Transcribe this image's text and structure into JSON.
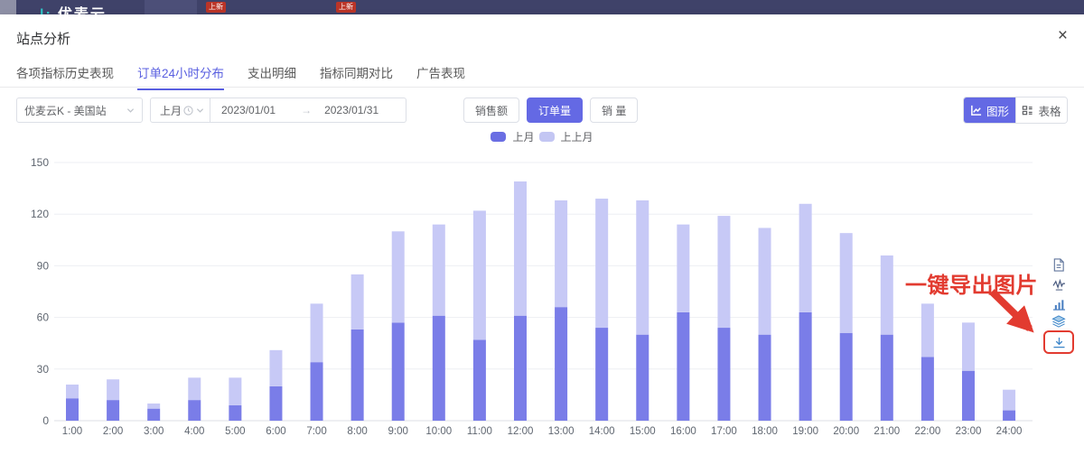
{
  "topbar": {
    "logo": "优麦云",
    "nav_badge_1": "上新",
    "nav_badge_2": "上新"
  },
  "modal": {
    "title": "站点分析",
    "close": "×"
  },
  "tabs": [
    {
      "label": "各项指标历史表现",
      "active": false
    },
    {
      "label": "订单24小时分布",
      "active": true
    },
    {
      "label": "支出明细",
      "active": false
    },
    {
      "label": "指标同期对比",
      "active": false
    },
    {
      "label": "广告表现",
      "active": false
    }
  ],
  "filters": {
    "site": "优麦云K - 美国站",
    "period": "上月",
    "date_start": "2023/01/01",
    "date_arrow": "→",
    "date_end": "2023/01/31"
  },
  "metric_buttons": [
    {
      "label": "销售额",
      "active": false
    },
    {
      "label": "订单量",
      "active": true
    },
    {
      "label": "销 量",
      "active": false
    }
  ],
  "view_toggle": [
    {
      "label": "图形",
      "active": true,
      "icon": "chart-icon"
    },
    {
      "label": "表格",
      "active": false,
      "icon": "table-icon"
    }
  ],
  "annotation": {
    "text": "一键导出图片",
    "color": "#e23b30"
  },
  "side_icons": [
    "document-icon",
    "trend-line-icon",
    "bar-chart-icon",
    "layers-icon",
    "download-icon"
  ],
  "chart_data": {
    "type": "bar",
    "stacked": true,
    "title": "",
    "xlabel": "",
    "ylabel": "",
    "ylim": [
      0,
      150
    ],
    "yticks": [
      0,
      30,
      60,
      90,
      120,
      150
    ],
    "grid": true,
    "legend_position": "top-center",
    "categories": [
      "1:00",
      "2:00",
      "3:00",
      "4:00",
      "5:00",
      "6:00",
      "7:00",
      "8:00",
      "9:00",
      "10:00",
      "11:00",
      "12:00",
      "13:00",
      "14:00",
      "15:00",
      "16:00",
      "17:00",
      "18:00",
      "19:00",
      "20:00",
      "21:00",
      "22:00",
      "23:00",
      "24:00"
    ],
    "series": [
      {
        "name": "上月",
        "color": "#7a7de8",
        "values": [
          13,
          12,
          7,
          12,
          9,
          20,
          34,
          53,
          57,
          61,
          47,
          61,
          66,
          54,
          50,
          63,
          54,
          50,
          63,
          51,
          50,
          37,
          29,
          6
        ]
      },
      {
        "name": "上上月",
        "color": "#c7c9f6",
        "values": [
          8,
          12,
          3,
          13,
          16,
          21,
          34,
          32,
          53,
          53,
          75,
          78,
          62,
          75,
          78,
          51,
          65,
          62,
          63,
          58,
          46,
          31,
          28,
          12
        ]
      }
    ]
  },
  "legend_swatches": {
    "prev": "#6a6ee3",
    "prev2": "#c3c6f3"
  }
}
